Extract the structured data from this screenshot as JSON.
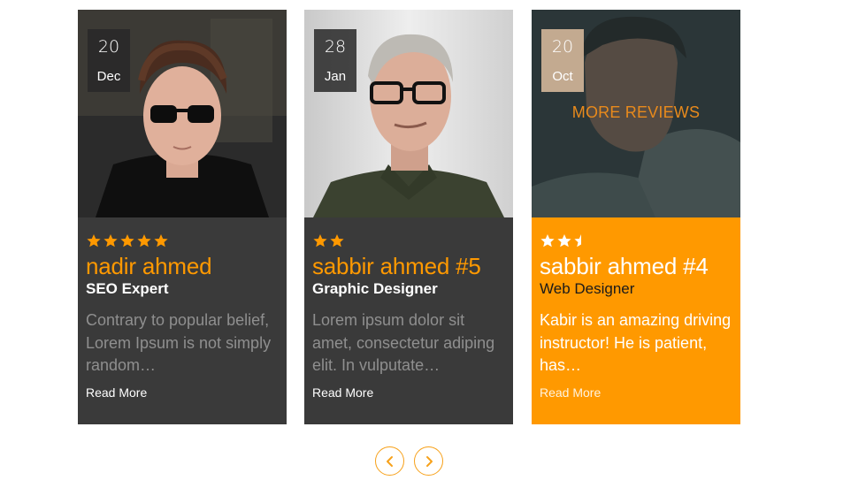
{
  "cards": [
    {
      "date": {
        "day": "20",
        "month": "Dec"
      },
      "rating": 5,
      "name": "nadir ahmed",
      "role": "SEO Expert",
      "excerpt": "Contrary to popular belief, Lorem Ipsum is not simply random…",
      "read_more": "Read More"
    },
    {
      "date": {
        "day": "28",
        "month": "Jan"
      },
      "rating": 2,
      "name": "sabbir ahmed #5",
      "role": "Graphic Designer",
      "excerpt": "Lorem ipsum dolor sit amet, consectetur adiping elit. In vulputate…",
      "read_more": "Read More"
    },
    {
      "date": {
        "day": "20",
        "month": "Oct"
      },
      "rating": 2.5,
      "overlay_link": "MORE REVIEWS",
      "name": "sabbir ahmed #4",
      "role": "Web Designer",
      "excerpt": "Kabir is an amazing driving instructor! He is patient, has…",
      "read_more": "Read More"
    }
  ],
  "icons": {
    "star": "star-icon",
    "half_star": "half-star-icon",
    "prev": "chevron-left-icon",
    "next": "chevron-right-icon"
  },
  "colors": {
    "accent": "#ff9900",
    "card_bg": "#3a3a3a",
    "overlay_text": "#e88a1c"
  }
}
